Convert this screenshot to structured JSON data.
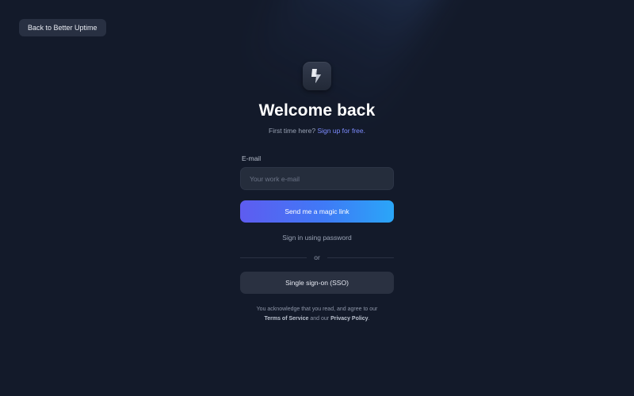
{
  "header": {
    "back_label": "Back to Better Uptime"
  },
  "logo": {
    "icon": "lightning-bolt-icon"
  },
  "hero": {
    "title": "Welcome back",
    "subtitle_prefix": "First time here?",
    "signup_link": "Sign up for free."
  },
  "form": {
    "email_label": "E-mail",
    "email_placeholder": "Your work e-mail",
    "email_value": "",
    "magic_link_button": "Send me a magic link",
    "password_link": "Sign in using password",
    "divider_text": "or",
    "sso_button": "Single sign-on (SSO)"
  },
  "legal": {
    "line1": "You acknowledge that you read, and agree to our",
    "terms": "Terms of Service",
    "and_our": "and our",
    "privacy": "Privacy Policy",
    "period": "."
  },
  "colors": {
    "background": "#131a2a",
    "accent_link": "#7d8cff",
    "button_gradient_start": "#5e5cf0",
    "button_gradient_end": "#2aa6f8"
  }
}
